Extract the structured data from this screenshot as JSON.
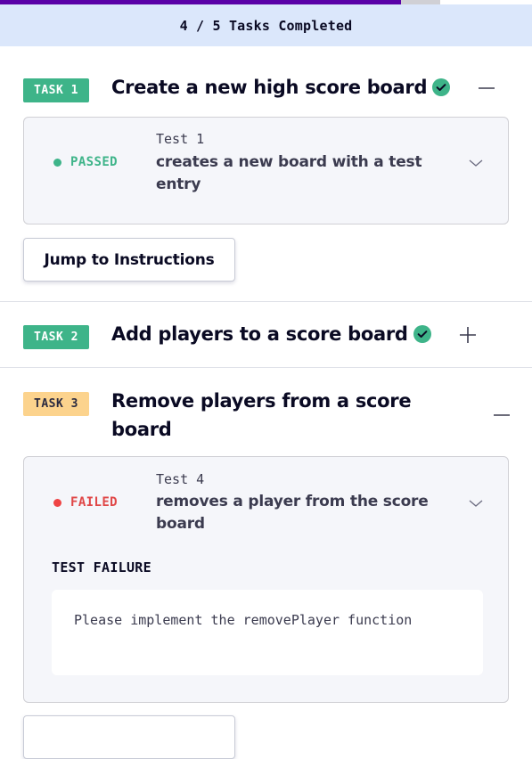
{
  "progress": {
    "completed": 4,
    "total": 5,
    "label": "4 / 5 Tasks Completed",
    "fill_color": "#5a01a7"
  },
  "colors": {
    "passed": "#3eb489",
    "failed": "#ef4444",
    "badge_incomplete": "#fcd38d",
    "header_bg": "#dbe7fb"
  },
  "tasks": [
    {
      "badge": "TASK 1",
      "title": "Create a new high score board",
      "completed": true,
      "expanded": true,
      "toggle_icon": "minus-icon",
      "test": {
        "status": "PASSED",
        "name": "Test 1",
        "description": "creates a new board with a test entry"
      },
      "jump_label": "Jump to Instructions"
    },
    {
      "badge": "TASK 2",
      "title": "Add players to a score board",
      "completed": true,
      "expanded": false,
      "toggle_icon": "plus-icon"
    },
    {
      "badge": "TASK 3",
      "title": "Remove players from a score board",
      "completed": false,
      "expanded": true,
      "toggle_icon": "minus-icon",
      "test": {
        "status": "FAILED",
        "name": "Test 4",
        "description": "removes a player from the score board",
        "failure_heading": "TEST FAILURE",
        "failure_message": "Please implement the removePlayer function"
      }
    }
  ]
}
